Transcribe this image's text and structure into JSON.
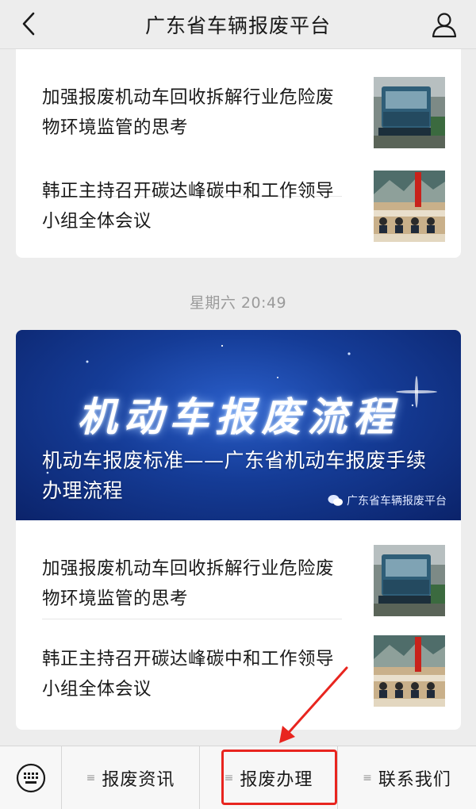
{
  "header": {
    "title": "广东省车辆报废平台",
    "back_icon": "chevron-left-icon",
    "user_icon": "user-icon"
  },
  "feed": {
    "top_card": {
      "articles": [
        {
          "title": "加强报废机动车回收拆解行业危险废物环境监管的思考",
          "thumb": "truck-thumbnail"
        },
        {
          "title": "韩正主持召开碳达峰碳中和工作领导小组全体会议",
          "thumb": "meeting-thumbnail"
        }
      ]
    },
    "timestamp": "星期六 20:49",
    "bottom_card": {
      "banner": {
        "big_text": "机动车报废流程",
        "title": "机动车报废标准——广东省机动车报废手续办理流程",
        "source": "广东省车辆报废平台",
        "source_icon": "wechat-icon"
      },
      "articles": [
        {
          "title": "加强报废机动车回收拆解行业危险废物环境监管的思考",
          "thumb": "truck-thumbnail"
        },
        {
          "title": "韩正主持召开碳达峰碳中和工作领导小组全体会议",
          "thumb": "meeting-thumbnail"
        }
      ]
    }
  },
  "menu": {
    "keyboard_icon": "keyboard-icon",
    "items": [
      {
        "label": "报废资讯"
      },
      {
        "label": "报废办理"
      },
      {
        "label": "联系我们"
      }
    ]
  },
  "annotation": {
    "color": "#e8251f",
    "target": "报废办理"
  },
  "colors": {
    "background": "#ededed",
    "card": "#ffffff",
    "banner": "#153c97"
  }
}
